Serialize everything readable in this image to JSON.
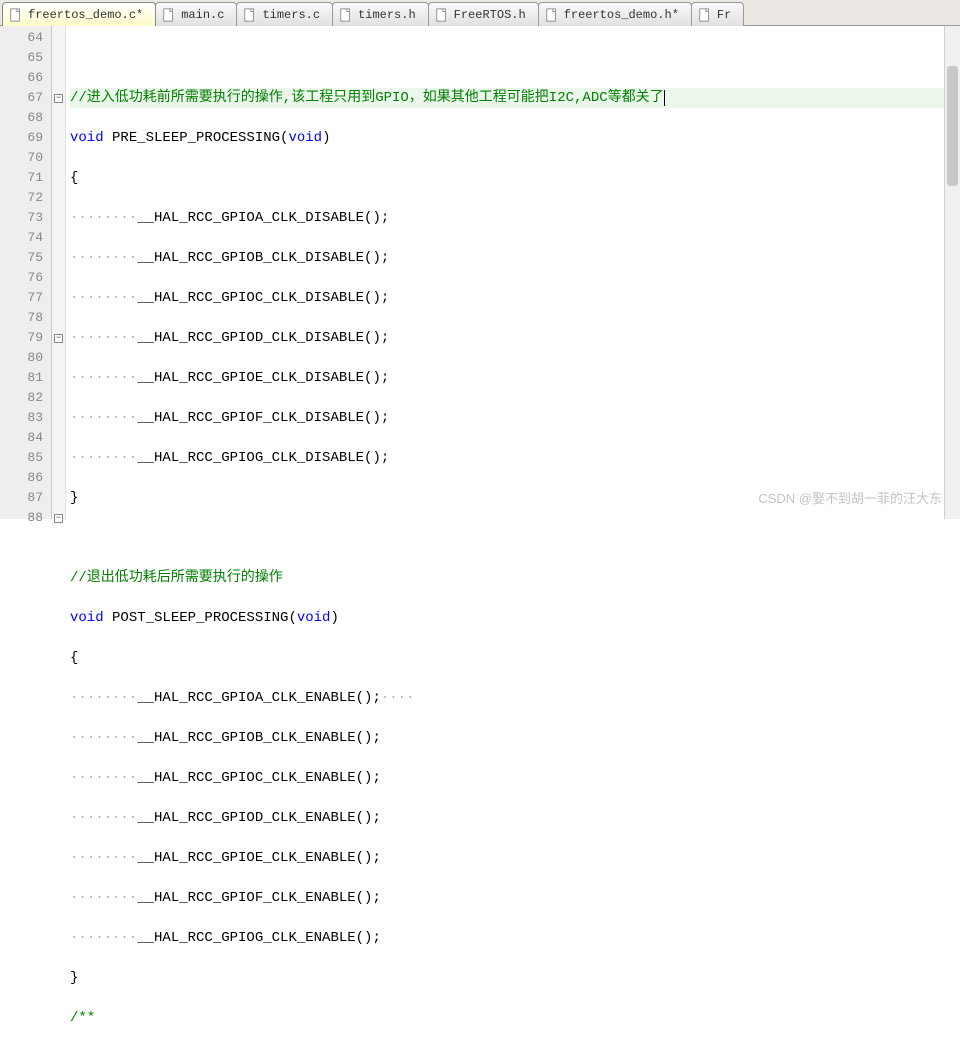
{
  "tabs": [
    {
      "label": "freertos_demo.c*",
      "active": true,
      "icon": "c"
    },
    {
      "label": "main.c",
      "active": false,
      "icon": "c"
    },
    {
      "label": "timers.c",
      "active": false,
      "icon": "c"
    },
    {
      "label": "timers.h",
      "active": false,
      "icon": "h"
    },
    {
      "label": "FreeRTOS.h",
      "active": false,
      "icon": "h"
    },
    {
      "label": "freertos_demo.h*",
      "active": false,
      "icon": "h"
    },
    {
      "label": "Fr",
      "active": false,
      "icon": "h"
    }
  ],
  "lines": {
    "l64": "64",
    "l65": "65",
    "l66": "66",
    "l67": "67",
    "l68": "68",
    "l69": "69",
    "l70": "70",
    "l71": "71",
    "l72": "72",
    "l73": "73",
    "l74": "74",
    "l75": "75",
    "l76": "76",
    "l77": "77",
    "l78": "78",
    "l79": "79",
    "l80": "80",
    "l81": "81",
    "l82": "82",
    "l83": "83",
    "l84": "84",
    "l85": "85",
    "l86": "86",
    "l87": "87",
    "l88": "88"
  },
  "code": {
    "c64": "",
    "c65_comment": "//进入低功耗前所需要执行的操作,该工程只用到GPIO，如果其他工程可能把I2C,ADC等都关了",
    "c66_kw1": "void",
    "c66_fn": " PRE_SLEEP_PROCESSING(",
    "c66_kw2": "void",
    "c66_close": ")",
    "c67": "{",
    "c68_ws": "········",
    "c68": "__HAL_RCC_GPIOA_CLK_DISABLE();",
    "c69_ws": "········",
    "c69": "__HAL_RCC_GPIOB_CLK_DISABLE();",
    "c70_ws": "········",
    "c70": "__HAL_RCC_GPIOC_CLK_DISABLE();",
    "c71_ws": "········",
    "c71": "__HAL_RCC_GPIOD_CLK_DISABLE();",
    "c72_ws": "········",
    "c72": "__HAL_RCC_GPIOE_CLK_DISABLE();",
    "c73_ws": "········",
    "c73": "__HAL_RCC_GPIOF_CLK_DISABLE();",
    "c74_ws": "········",
    "c74": "__HAL_RCC_GPIOG_CLK_DISABLE();",
    "c75": "}",
    "c76": "",
    "c77_comment": "//退出低功耗后所需要执行的操作",
    "c78_kw1": "void",
    "c78_fn": " POST_SLEEP_PROCESSING(",
    "c78_kw2": "void",
    "c78_close": ")",
    "c79": "{",
    "c80_ws": "········",
    "c80": "__HAL_RCC_GPIOA_CLK_ENABLE();",
    "c80_tail_ws": "····",
    "c81_ws": "········",
    "c81": "__HAL_RCC_GPIOB_CLK_ENABLE();",
    "c82_ws": "········",
    "c82": "__HAL_RCC_GPIOC_CLK_ENABLE();",
    "c83_ws": "········",
    "c83": "__HAL_RCC_GPIOD_CLK_ENABLE();",
    "c84_ws": "········",
    "c84": "__HAL_RCC_GPIOE_CLK_ENABLE();",
    "c85_ws": "········",
    "c85": "__HAL_RCC_GPIOF_CLK_ENABLE();",
    "c86_ws": "········",
    "c86": "__HAL_RCC_GPIOG_CLK_ENABLE();",
    "c87": "}",
    "c88_comment": "/**"
  },
  "fold": {
    "minus": "−"
  },
  "watermark": "CSDN @娶不到胡一菲的汪大东"
}
